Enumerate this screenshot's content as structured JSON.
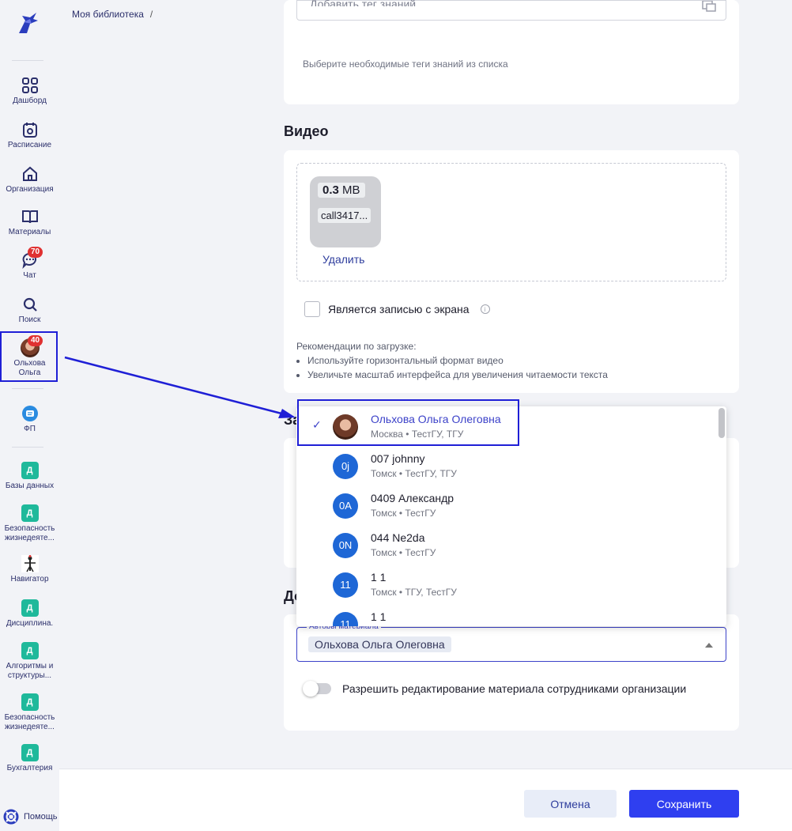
{
  "breadcrumb": {
    "root": "Моя библиотека",
    "separator": "/"
  },
  "sidebar": {
    "items": [
      {
        "label": "Дашборд",
        "icon": "grid-icon"
      },
      {
        "label": "Расписание",
        "icon": "calendar-icon"
      },
      {
        "label": "Организация",
        "icon": "home-icon"
      },
      {
        "label": "Материалы",
        "icon": "book-icon"
      },
      {
        "label": "Чат",
        "icon": "chat-icon",
        "badge": "70"
      },
      {
        "label": "Поиск",
        "icon": "search-icon"
      },
      {
        "label_line1": "Ольхова",
        "label_line2": "Ольга",
        "badge": "40"
      },
      {
        "label": "ФП",
        "icon": "fp-icon"
      }
    ],
    "courses": [
      {
        "letter": "Д",
        "label": "Базы данных"
      },
      {
        "letter": "Д",
        "label_line1": "Безопасность",
        "label_line2": "жизнедеяте..."
      },
      {
        "letter": "",
        "label": "Навигатор"
      },
      {
        "letter": "Д",
        "label": "Дисциплина."
      },
      {
        "letter": "Д",
        "label_line1": "Алгоритмы и",
        "label_line2": "структуры..."
      },
      {
        "letter": "Д",
        "label_line1": "Безопасность",
        "label_line2": "жизнедеяте..."
      },
      {
        "letter": "Д",
        "label": "Бухгалтерия"
      }
    ],
    "help": "Помощь"
  },
  "tags": {
    "placeholder": "Добавить тег знаний",
    "hint": "Выберите необходимые теги знаний из списка"
  },
  "video": {
    "title": "Видео",
    "file_size_value": "0.3",
    "file_size_unit": "MB",
    "file_name": "call3417...",
    "delete_label": "Удалить",
    "screen_recording_label": "Является записью с экрана",
    "info_symbol": "i",
    "recommendations_title": "Рекомендации по загрузке:",
    "recommendations": [
      "Используйте горизонтальный формат видео",
      "Увеличьте масштаб интерфейса для увеличения читаемости текста"
    ]
  },
  "hidden_titles": {
    "partial_1": "За",
    "partial_2": "До"
  },
  "authors": {
    "field_label": "Авторы материала",
    "selected_chip": "Ольхова Ольга Олеговна",
    "toggle_label": "Разрешить редактирование материала сотрудниками организации",
    "toggle_on": false
  },
  "dropdown": {
    "check_symbol": "✓",
    "options": [
      {
        "initials": "",
        "name": "Ольхова Ольга Олеговна",
        "sub": "Москва • ТестГУ, ТГУ",
        "selected": true
      },
      {
        "initials": "0j",
        "name": "007 johnny",
        "sub": "Томск • ТестГУ, ТГУ"
      },
      {
        "initials": "0А",
        "name": "0409 Александр",
        "sub": "Томск • ТестГУ"
      },
      {
        "initials": "0N",
        "name": "044 Ne2da",
        "sub": "Томск • ТестГУ"
      },
      {
        "initials": "11",
        "name": "1 1",
        "sub": "Томск • ТГУ, ТестГУ"
      },
      {
        "initials": "11",
        "name": "1 1",
        "sub": ""
      }
    ]
  },
  "footer": {
    "cancel": "Отмена",
    "save": "Сохранить"
  },
  "colors": {
    "accent": "#2f3ff0",
    "highlight": "#1f1fd6",
    "badge": "#e03131",
    "course": "#1fb99b"
  }
}
